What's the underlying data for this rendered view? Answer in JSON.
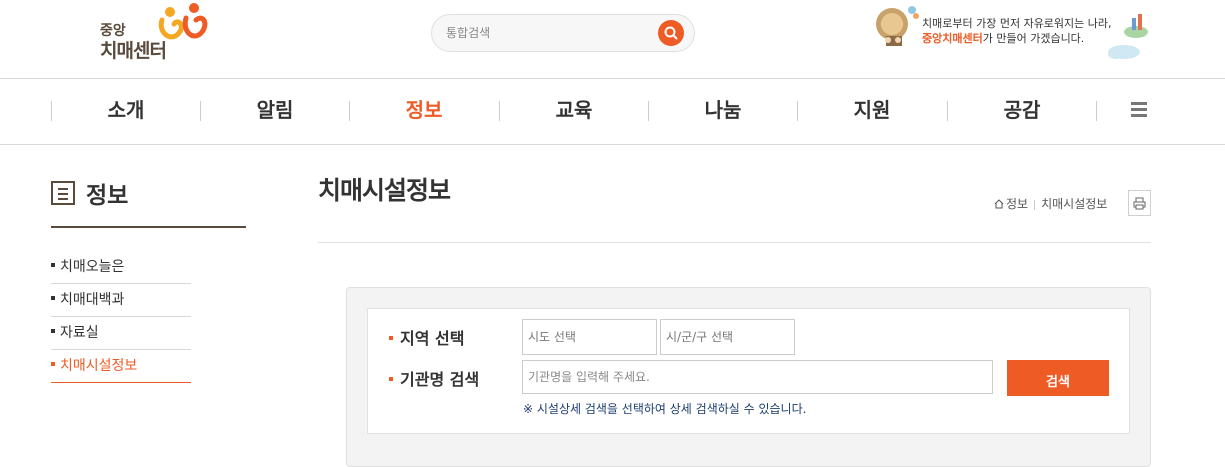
{
  "header": {
    "logo_small": "중앙",
    "logo_big": "치매센터",
    "search_placeholder": "통합검색",
    "slogan_line1": "치매로부터 가장 먼저 자유로워지는 나라,",
    "slogan_highlight": "중앙치매센터",
    "slogan_line2_rest": "가 만들어 가겠습니다.",
    "brand_color": "#ee5b24"
  },
  "gnb": {
    "items": [
      {
        "label": "소개"
      },
      {
        "label": "알림"
      },
      {
        "label": "정보",
        "active": true
      },
      {
        "label": "교육"
      },
      {
        "label": "나눔"
      },
      {
        "label": "지원"
      },
      {
        "label": "공감"
      }
    ],
    "menu_icon": "hamburger-icon"
  },
  "side": {
    "title": "정보",
    "title_icon": "document-icon",
    "items": [
      {
        "label": "치매오늘은"
      },
      {
        "label": "치매대백과"
      },
      {
        "label": "자료실"
      },
      {
        "label": "치매시설정보",
        "active": true
      }
    ]
  },
  "main": {
    "title": "치매시설정보",
    "breadcrumb": [
      "정보",
      "치매시설정보"
    ],
    "print_icon": "print-icon",
    "search": {
      "region_label": "지역 선택",
      "sido_select": "시도 선택",
      "sigungu_select": "시/군/구 선택",
      "name_label": "기관명 검색",
      "name_placeholder": "기관명을 입력해 주세요.",
      "submit_label": "검색",
      "note": "※ 시설상세 검색을 선택하여 상세 검색하실 수 있습니다."
    }
  }
}
